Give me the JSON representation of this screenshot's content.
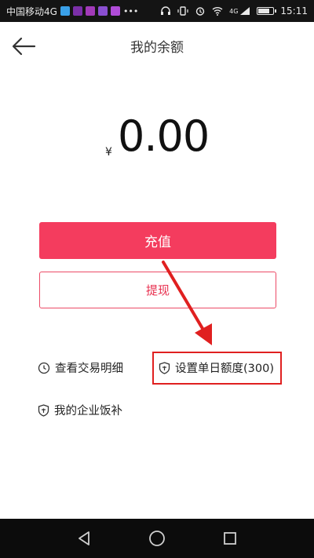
{
  "status_bar": {
    "carrier": "中国移动4G",
    "time": "15:11",
    "network": "4G",
    "notification_colors": [
      "#3aa0e8",
      "#7b2fa8",
      "#a23ab8",
      "#8a4fd0",
      "#b04cd8"
    ]
  },
  "header": {
    "title": "我的余额",
    "back_icon": "arrow-left-icon"
  },
  "balance": {
    "currency": "¥",
    "value": "0.00"
  },
  "actions": {
    "recharge_label": "充值",
    "withdraw_label": "提现"
  },
  "links": {
    "transactions": "查看交易明细",
    "daily_limit": "设置单日额度(300)",
    "corp_meal": "我的企业饭补"
  },
  "colors": {
    "accent": "#f43c5e",
    "annotation": "#e02020"
  }
}
